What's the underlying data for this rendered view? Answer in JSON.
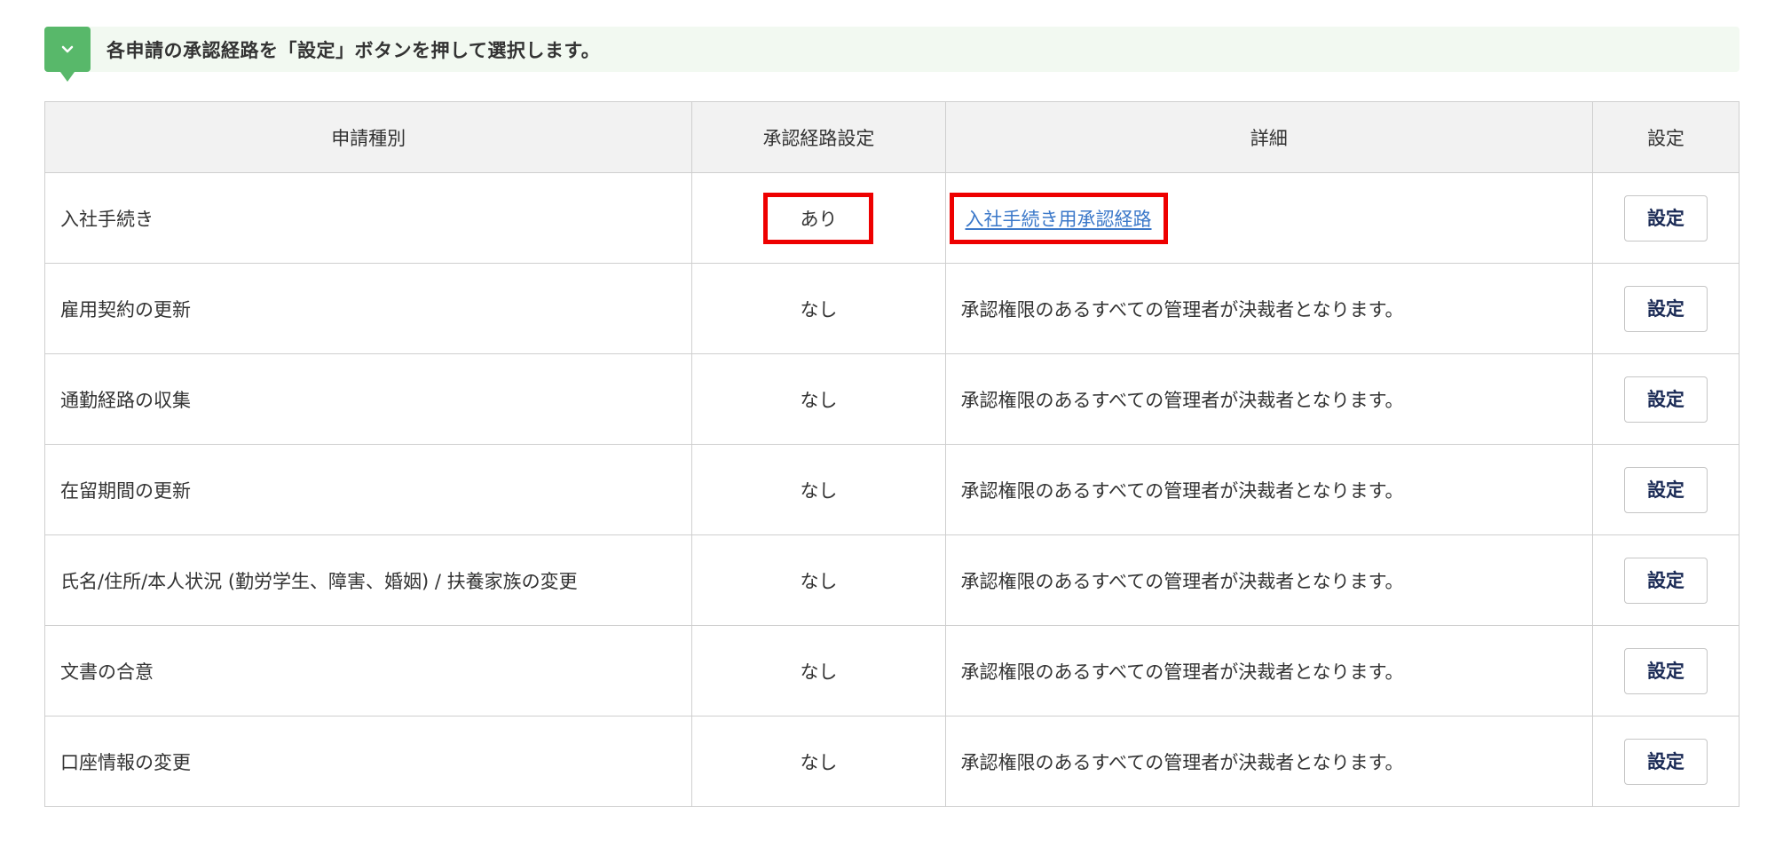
{
  "step_banner": {
    "icon": "chevron-down-icon",
    "text": "各申請の承認経路を「設定」ボタンを押して選択します。",
    "badge_color": "#58b86a",
    "background_color": "#f2f9f1"
  },
  "table": {
    "headers": {
      "type": "申請種別",
      "setting": "承認経路設定",
      "detail": "詳細",
      "action": "設定"
    },
    "rows": [
      {
        "type": "入社手続き",
        "setting": "あり",
        "detail": "入社手続き用承認経路",
        "detail_is_link": true,
        "highlighted": true,
        "button": "設定"
      },
      {
        "type": "雇用契約の更新",
        "setting": "なし",
        "detail": "承認権限のあるすべての管理者が決裁者となります。",
        "button": "設定"
      },
      {
        "type": "通勤経路の収集",
        "setting": "なし",
        "detail": "承認権限のあるすべての管理者が決裁者となります。",
        "button": "設定"
      },
      {
        "type": "在留期間の更新",
        "setting": "なし",
        "detail": "承認権限のあるすべての管理者が決裁者となります。",
        "button": "設定"
      },
      {
        "type": "氏名/住所/本人状況 (勤労学生、障害、婚姻) / 扶養家族の変更",
        "setting": "なし",
        "detail": "承認権限のあるすべての管理者が決裁者となります。",
        "button": "設定"
      },
      {
        "type": "文書の合意",
        "setting": "なし",
        "detail": "承認権限のあるすべての管理者が決裁者となります。",
        "button": "設定"
      },
      {
        "type": "口座情報の変更",
        "setting": "なし",
        "detail": "承認権限のあるすべての管理者が決裁者となります。",
        "button": "設定"
      }
    ]
  },
  "colors": {
    "highlight": "#ee0000",
    "link": "#3b78c9",
    "button_text": "#1a2a55",
    "header_bg": "#f2f2f2",
    "border": "#cfcfcf"
  }
}
